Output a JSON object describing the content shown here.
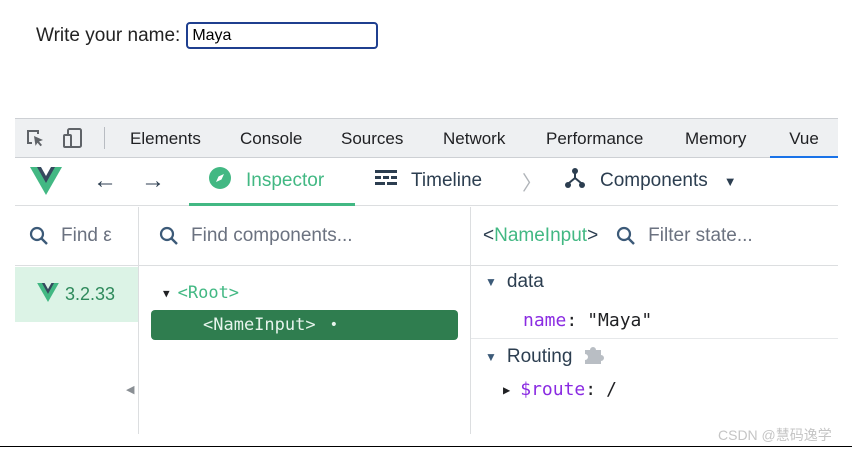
{
  "page": {
    "label": "Write your name:",
    "input_value": "Maya"
  },
  "devtools": {
    "tabs": [
      "Elements",
      "Console",
      "Sources",
      "Network",
      "Performance",
      "Memory",
      "Vue"
    ],
    "active_tab": "Vue",
    "icons": [
      "inspect-element-icon",
      "device-toolbar-icon"
    ]
  },
  "vue_bar": {
    "inspector_label": "Inspector",
    "timeline_label": "Timeline",
    "components_label": "Components",
    "accent": "#42b883"
  },
  "left_pane": {
    "search_placeholder": "Find ε",
    "version": "3.2.33"
  },
  "tree_pane": {
    "search_placeholder": "Find components...",
    "root_label": "<Root>",
    "selected_label": "<NameInput>",
    "selected_dot": "•"
  },
  "state_pane": {
    "component_name": "<NameInput>",
    "filter_placeholder": "Filter state...",
    "data_section": "data",
    "data_key": "name",
    "data_colon": ":",
    "data_value": "\"Maya\"",
    "routing_section": "Routing",
    "route_key": "$route",
    "route_colon": ":",
    "route_value": "/"
  },
  "watermark": "CSDN @慧码逸学"
}
